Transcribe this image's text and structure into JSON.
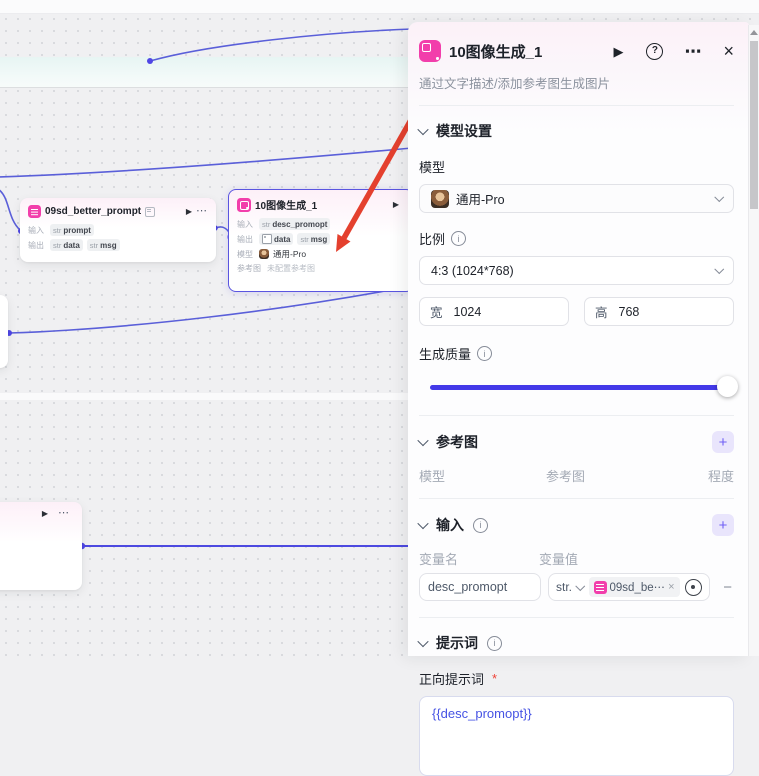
{
  "colors": {
    "accent_pink": "#f23eab",
    "edge_blue": "#5a5fd9",
    "slider_blue": "#4339e8",
    "arrow_red": "#e4402e",
    "selected_border": "#5a55e0"
  },
  "panel": {
    "title": "10图像生成_1",
    "run_icon": "▶",
    "more_icon": "⋯",
    "close_icon": "×",
    "subtitle": "通过文字描述/添加参考图生成图片",
    "model_section": {
      "title": "模型设置",
      "model_label": "模型",
      "model_value": "通用-Pro",
      "ratio_label": "比例",
      "ratio_value": "4:3 (1024*768)",
      "width_label": "宽",
      "width_value": "1024",
      "height_label": "高",
      "height_value": "768",
      "quality_label": "生成质量"
    },
    "reference_section": {
      "title": "参考图",
      "add_label": "+",
      "col_model": "模型",
      "col_image": "参考图",
      "col_degree": "程度"
    },
    "input_section": {
      "title": "输入",
      "add_label": "+",
      "col_name": "变量名",
      "col_value": "变量值",
      "var_name": "desc_promopt",
      "var_type": "str.",
      "ref_name": "09sd_be⋯",
      "remove_label": "×",
      "minus_label": "−"
    },
    "prompt_section": {
      "title": "提示词",
      "positive_label": "正向提示词",
      "required": "*",
      "value": "{{desc_promopt}}"
    }
  },
  "canvas": {
    "node1": {
      "title": "09sd_better_prompt",
      "play": "▶",
      "more": "⋯",
      "in_label": "输入",
      "out_label": "输出",
      "in_tags": [
        {
          "type": "str",
          "name": "prompt"
        }
      ],
      "out_tags": [
        {
          "type": "str",
          "name": "data"
        },
        {
          "type": "str",
          "name": "msg"
        }
      ]
    },
    "node2": {
      "title": "10图像生成_1",
      "play": "▶",
      "in_label": "输入",
      "out_label": "输出",
      "model_label": "模型",
      "ref_label": "参考图",
      "in_type": "str",
      "in_name": "desc_promopt",
      "out1_name": "data",
      "out2_type": "str",
      "out2_name": "msg",
      "model_value": "通用-Pro",
      "ref_value": "未配置参考图"
    },
    "node4": {
      "play": "▶",
      "more": "⋯"
    }
  }
}
